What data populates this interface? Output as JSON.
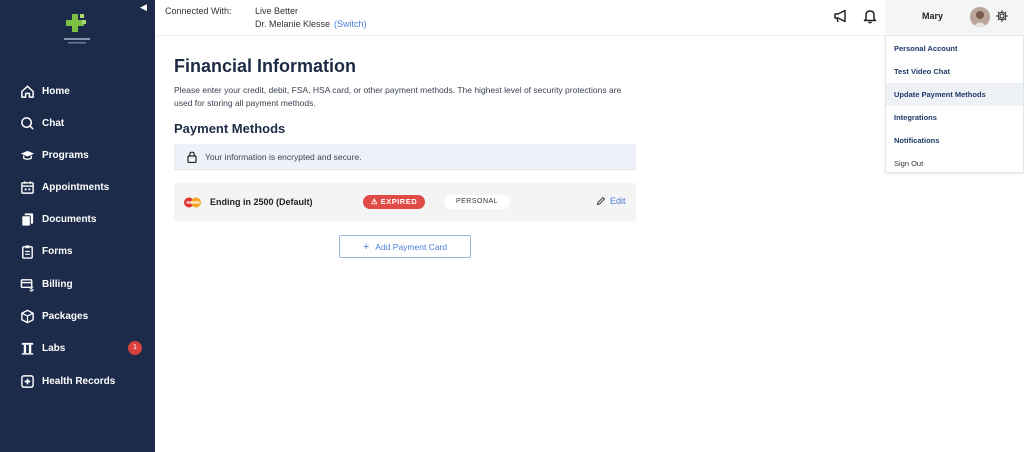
{
  "sidebar": {
    "items": [
      {
        "label": "Home",
        "icon": "home-icon"
      },
      {
        "label": "Chat",
        "icon": "chat-icon"
      },
      {
        "label": "Programs",
        "icon": "graduation-cap-icon"
      },
      {
        "label": "Appointments",
        "icon": "calendar-icon"
      },
      {
        "label": "Documents",
        "icon": "documents-icon"
      },
      {
        "label": "Forms",
        "icon": "clipboard-icon"
      },
      {
        "label": "Billing",
        "icon": "billing-icon"
      },
      {
        "label": "Packages",
        "icon": "package-icon"
      },
      {
        "label": "Labs",
        "icon": "labs-icon",
        "badge": "1"
      },
      {
        "label": "Health Records",
        "icon": "health-records-icon"
      }
    ]
  },
  "header": {
    "connected_label": "Connected With:",
    "organization": "Live Better",
    "provider": "Dr. Melanie Klesse",
    "switch_label": "(Switch)",
    "user_name": "Mary"
  },
  "dropdown": {
    "items": [
      {
        "label": "Personal Account"
      },
      {
        "label": "Test Video Chat"
      },
      {
        "label": "Update Payment Methods"
      },
      {
        "label": "Integrations"
      },
      {
        "label": "Notifications"
      },
      {
        "label": "Sign Out"
      }
    ]
  },
  "main": {
    "title": "Financial Information",
    "description": "Please enter your credit, debit, FSA, HSA card, or other payment methods. The highest level of security protections are used for storing all payment methods.",
    "section_title": "Payment Methods",
    "secure_notice": "Your information is encrypted and secure.",
    "card": {
      "label": "Ending in 2500 (Default)",
      "status": "EXPIRED",
      "type": "PERSONAL",
      "edit_label": "Edit"
    },
    "add_button": "Add Payment Card"
  },
  "colors": {
    "sidebar": "#1c2b4a",
    "accent": "#4a7fd8",
    "expired": "#e04a47",
    "badge": "#d9413d"
  }
}
